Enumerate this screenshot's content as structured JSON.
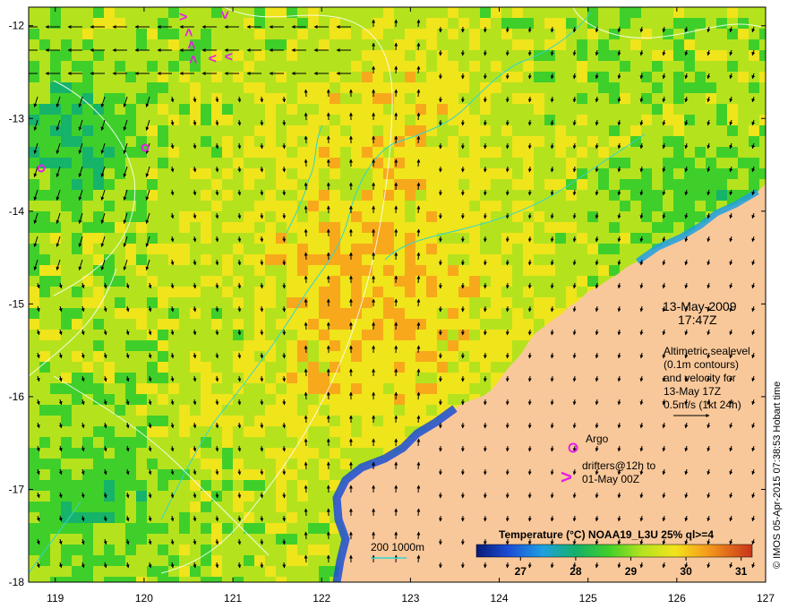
{
  "map": {
    "lon_range": [
      118.7,
      127
    ],
    "lat_range": [
      -18,
      -11.8
    ],
    "lon_ticks": [
      "119",
      "120",
      "121",
      "122",
      "123",
      "124",
      "125",
      "126",
      "127"
    ],
    "lat_ticks": [
      "-12",
      "-13",
      "-14",
      "-15",
      "-16",
      "-17",
      "-18"
    ],
    "land_color": "#f9c89a",
    "ocean_palette": [
      "#0a1f8c",
      "#1b5fd6",
      "#1fa0e0",
      "#16b36a",
      "#3fcf2a",
      "#b4e31e",
      "#f0e41b",
      "#f7a91b",
      "#e8531a"
    ]
  },
  "info": {
    "date": "13-May-2009",
    "time": "17:47Z",
    "altimetric_lines": [
      "Altimetric sealevel",
      "(0.1m contours)",
      "and velocity for",
      "13-May 17Z",
      "0.5m/s (1kt 24h)"
    ]
  },
  "legend": {
    "argo_label": "Argo",
    "drifter_lines": [
      "drifters@12h to",
      "01-May 00Z"
    ],
    "depth_label": "200  1000m",
    "marker_color": "#e61ee6"
  },
  "colorbar": {
    "title": "Temperature (°C) NOAA19_L3U 25% ql>=4",
    "ticks": [
      "27",
      "28",
      "29",
      "30",
      "31"
    ],
    "range": [
      26.2,
      31.2
    ]
  },
  "credit": "© IMOS 05-Apr-2015 07:38:53 Hobart time"
}
